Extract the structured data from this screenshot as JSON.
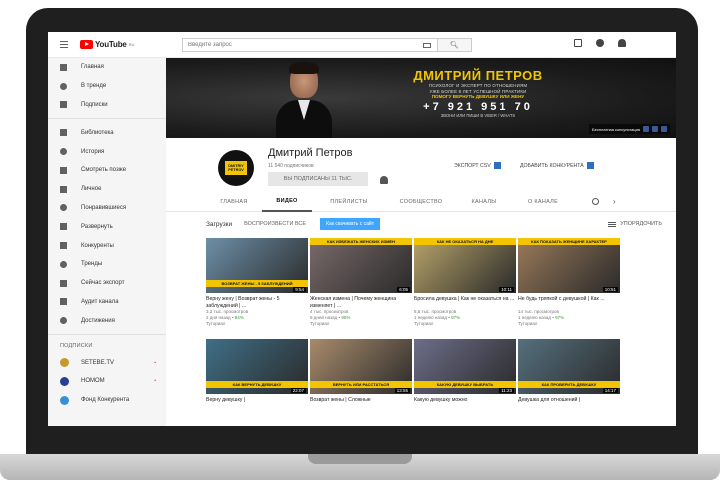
{
  "browser": {
    "logo_text": "YouTube",
    "logo_country": "RU",
    "search_placeholder": "Введите запрос"
  },
  "sidebar": {
    "main": [
      {
        "label": "Главная",
        "icon": "home-icon"
      },
      {
        "label": "В тренде",
        "icon": "fire-icon"
      },
      {
        "label": "Подписки",
        "icon": "subscriptions-icon"
      }
    ],
    "library": [
      {
        "label": "Библиотека",
        "icon": "library-icon"
      },
      {
        "label": "История",
        "icon": "history-icon"
      },
      {
        "label": "Смотреть позже",
        "icon": "clock-icon"
      },
      {
        "label": "Личное",
        "icon": "folder-icon"
      },
      {
        "label": "Понравившиеся",
        "icon": "thumb-up-icon"
      },
      {
        "label": "Развернуть",
        "icon": "chevron-down-icon"
      },
      {
        "label": "Конкуренты",
        "icon": "competitors-icon"
      },
      {
        "label": "Тренды",
        "icon": "trends-icon"
      },
      {
        "label": "Сейчас экспорт",
        "icon": "export-icon"
      },
      {
        "label": "Аудит канала",
        "icon": "audit-icon"
      },
      {
        "label": "Достижения",
        "icon": "achievements-icon"
      }
    ],
    "subs_heading": "ПОДПИСКИ",
    "subscriptions": [
      {
        "label": "SETEBE.TV",
        "badge": "▪",
        "color": "#c49a2a"
      },
      {
        "label": "НОМОМ",
        "badge": "•",
        "color": "#2b3e8f"
      },
      {
        "label": "Фонд Конкурента",
        "badge": "",
        "color": "#3b8fd6"
      }
    ]
  },
  "banner": {
    "name": "ДМИТРИЙ ПЕТРОВ",
    "line1": "ПСИХОЛОГ И ЭКСПЕРТ ПО ОТНОШЕНИЯМ",
    "line2": "УЖЕ БОЛЕЕ 8 ЛЕТ УСПЕШНОЙ ПРАКТИКИ",
    "line3": "ПОМОГУ ВЕРНУТЬ ДЕВУШКУ ИЛИ ЖЕНУ",
    "phone": "+7 921 951 70",
    "line4": "ЗВОНИ ИЛИ ПИШИ В VIBER / WHATS",
    "link_text": "Бесплатная консультация"
  },
  "channel": {
    "avatar_text": "DMITRIY PETROV",
    "name": "Дмитрий Петров",
    "subscribers": "11 540 подписчиков",
    "subscribed_button": "ВЫ ПОДПИСАНЫ 11 ТЫС.",
    "export_label": "ЭКСПОРТ CSV",
    "compare_label": "ДОБАВИТЬ КОНКУРЕНТА"
  },
  "tabs": [
    "ГЛАВНАЯ",
    "ВИДЕО",
    "ПЛЕЙЛИСТЫ",
    "СООБЩЕСТВО",
    "КАНАЛЫ",
    "О КАНАЛЕ"
  ],
  "active_tab": "ВИДЕО",
  "filters": {
    "label": "Загрузки",
    "play_all": "ВОСПРОИЗВЕСТИ ВСЕ",
    "button": "Как скачивать с сайт",
    "sort": "УПОРЯДОЧИТЬ"
  },
  "videos": [
    {
      "title": "Верну жену | Возврат жены - 5 заблуждений | ...",
      "views": "3,2 тыс. просмотров",
      "age": "2 дня назад",
      "pct": "94%",
      "tag": "Туториал",
      "duration": "9:54",
      "caption": "ВОЗВРАТ ЖЕНЫ - 5 ЗАБЛУЖДЕНИЙ",
      "cap_pos": "bottom",
      "bg": "#6d8fa8"
    },
    {
      "title": "Женская измена | Почему женщина изменяет | ...",
      "views": "4 тыс. просмотров",
      "age": "6 дней назад",
      "pct": "95%",
      "tag": "Туториал",
      "duration": "6:05",
      "caption": "КАК ИЗБЕЖАТЬ ЖЕНСКИХ ИЗМЕН",
      "cap_pos": "top",
      "bg": "#7a6a6a"
    },
    {
      "title": "Бросила девушка | Как не оказаться на ...",
      "views": "8,5 тыс. просмотров",
      "age": "1 неделю назад",
      "pct": "97%",
      "tag": "Туториал",
      "duration": "10:11",
      "caption": "КАК НЕ ОКАЗАТЬСЯ НА ДНЕ",
      "cap_pos": "top",
      "bg": "#b8a46a"
    },
    {
      "title": "Не будь тряпкой с девушкой | Как ...",
      "views": "14 тыс. просмотров",
      "age": "1 неделю назад",
      "pct": "97%",
      "tag": "Туториал",
      "duration": "10:51",
      "caption": "КАК ПОКАЗАТЬ ЖЕНЩИНЕ ХАРАКТЕР",
      "cap_pos": "top",
      "bg": "#9a7a5a"
    },
    {
      "title": "Верну девушку |",
      "views": "",
      "age": "",
      "pct": "",
      "tag": "",
      "duration": "22:07",
      "caption": "КАК ВЕРНУТЬ ДЕВУШКУ",
      "cap_pos": "bottom",
      "bg": "#3f6f86"
    },
    {
      "title": "Возврат жены | Сложные",
      "views": "",
      "age": "",
      "pct": "",
      "tag": "",
      "duration": "13:55",
      "caption": "ВЕРНУТЬ ИЛИ РАССТАТЬСЯ",
      "cap_pos": "bottom",
      "bg": "#a88b6b"
    },
    {
      "title": "Какую девушку можно",
      "views": "",
      "age": "",
      "pct": "",
      "tag": "",
      "duration": "11:23",
      "caption": "КАКУЮ ДЕВУШКУ ВЫБРАТЬ",
      "cap_pos": "bottom",
      "bg": "#6d6d8a"
    },
    {
      "title": "Девушка для отношений |",
      "views": "",
      "age": "",
      "pct": "",
      "tag": "",
      "duration": "14:17",
      "caption": "КАК ПРОВЕРИТЬ ДЕВУШКУ",
      "cap_pos": "bottom",
      "bg": "#55707e"
    }
  ]
}
